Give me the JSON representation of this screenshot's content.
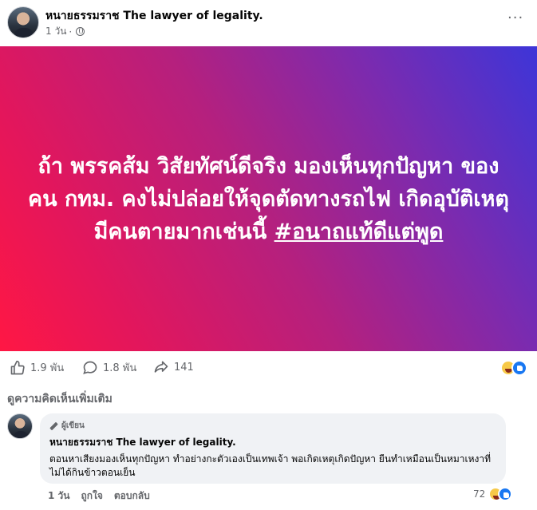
{
  "post": {
    "author": "หนายธรรมราช The lawyer of legality.",
    "time": "1 วัน",
    "more": "···",
    "banner_text_main": "ถ้า พรรคส้ม วิสัยทัศน์ดีจริง มองเห็นทุกปัญหา ของคน กทม. คงไม่ปล่อยให้จุดตัดทางรถไฟ เกิดอุบัติเหตุมีคนตายมากเช่นนี้",
    "banner_hashtag": "#อนาถแท้ดีแต่พูด"
  },
  "stats": {
    "likes": "1.9 พัน",
    "comments": "1.8 พัน",
    "shares": "141"
  },
  "comments_section": {
    "more_comments_label": "ดูความคิดเห็นเพิ่มเติม",
    "comment": {
      "badge": "ผู้เขียน",
      "author": "หนายธรรมราช The lawyer of legality.",
      "text": "ตอนหาเสียงมองเห็นทุกปัญหา ทำอย่างกะตัวเองเป็นเทพเจ้า พอเกิดเหตุเกิดปัญหา ยืนทำเหมือนเป็นหมาเหงาที่ไม่ได้กินข้าวตอนเย็น",
      "time": "1 วัน",
      "like_label": "ถูกใจ",
      "reply_label": "ตอบกลับ",
      "reaction_count": "72"
    }
  },
  "colors": {
    "banner_start": "#ff1744",
    "banner_end": "#3d35d8",
    "like_blue": "#1877f2"
  }
}
